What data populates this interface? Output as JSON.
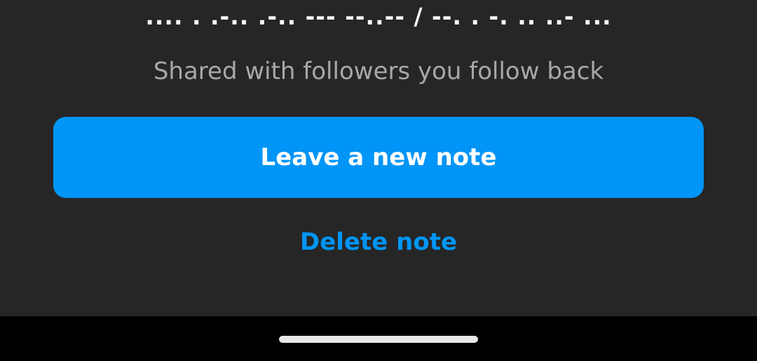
{
  "note": {
    "text": ".... . .-.. .-.. --- --..-- / --. . -. .. ..- ...",
    "audience": "Shared with followers you follow back"
  },
  "actions": {
    "primary_label": "Leave a new note",
    "secondary_label": "Delete note"
  },
  "colors": {
    "sheet_background": "#262626",
    "accent": "#0095f6",
    "primary_text": "#ffffff",
    "secondary_text": "#a8a8a8",
    "nav_bar": "#000000"
  }
}
